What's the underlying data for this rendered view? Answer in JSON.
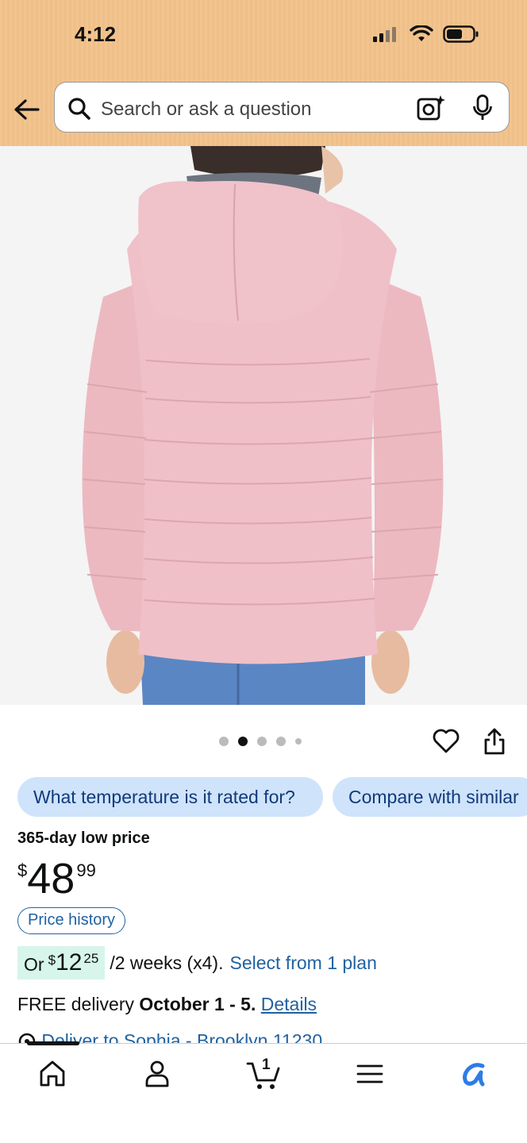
{
  "status_bar": {
    "time": "4:12"
  },
  "search": {
    "placeholder": "Search or ask a question"
  },
  "product": {
    "image_alt": "Pink quilted puffer jacket with hood, back view",
    "carousel": {
      "count": 5,
      "active_index": 1
    }
  },
  "ask_chips": [
    "What temperature is it rated for?",
    "Compare with similar"
  ],
  "deal_label": "365-day low price",
  "price": {
    "currency": "$",
    "whole": "48",
    "fraction": "99"
  },
  "price_history_label": "Price history",
  "installment": {
    "prefix": "Or",
    "currency": "$",
    "whole": "12",
    "fraction": "25",
    "terms": "/2 weeks (x4).",
    "link": "Select from 1 plan"
  },
  "delivery": {
    "prefix": "FREE delivery",
    "dates": "October 1 - 5.",
    "link": "Details"
  },
  "deliver_to": "Deliver to Sophia - Brooklyn 11230",
  "bottom_nav": {
    "items": [
      "home-icon",
      "account-icon",
      "cart-icon",
      "menu-icon",
      "rufus-icon"
    ],
    "cart_count": "1",
    "active_index": 0
  },
  "colors": {
    "header": "#f2c48f",
    "link": "#2162a1",
    "chip_bg": "#cfe3fb",
    "installment_bg": "#d7f5ea",
    "jacket": "#efbfc6"
  }
}
